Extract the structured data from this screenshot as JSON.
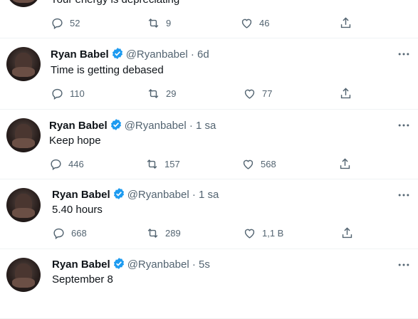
{
  "tweets": [
    {
      "name": "",
      "handle": "",
      "time": "",
      "text": "Your energy is depreciating",
      "replies": "52",
      "retweets": "9",
      "likes": "46"
    },
    {
      "name": "Ryan Babel",
      "handle": "@Ryanbabel",
      "time": "6d",
      "text": "Time is getting debased",
      "replies": "110",
      "retweets": "29",
      "likes": "77"
    },
    {
      "name": "Ryan Babel",
      "handle": "@Ryanbabel",
      "time": "1 sa",
      "text": "Keep hope",
      "replies": "446",
      "retweets": "157",
      "likes": "568"
    },
    {
      "name": "Ryan Babel",
      "handle": "@Ryanbabel",
      "time": "1 sa",
      "text": "5.40 hours",
      "replies": "668",
      "retweets": "289",
      "likes": "1,1 B"
    },
    {
      "name": "Ryan Babel",
      "handle": "@Ryanbabel",
      "time": "5s",
      "text": "September 8",
      "replies": "",
      "retweets": "",
      "likes": ""
    }
  ],
  "separator": " · ",
  "icons": {
    "reply": "reply-icon",
    "retweet": "retweet-icon",
    "like": "heart-icon",
    "share": "share-icon",
    "more": "more-icon",
    "verified": "verified-badge-icon"
  },
  "colors": {
    "verified": "#1d9bf0",
    "secondary_text": "#536471",
    "divider": "#eff3f4"
  }
}
